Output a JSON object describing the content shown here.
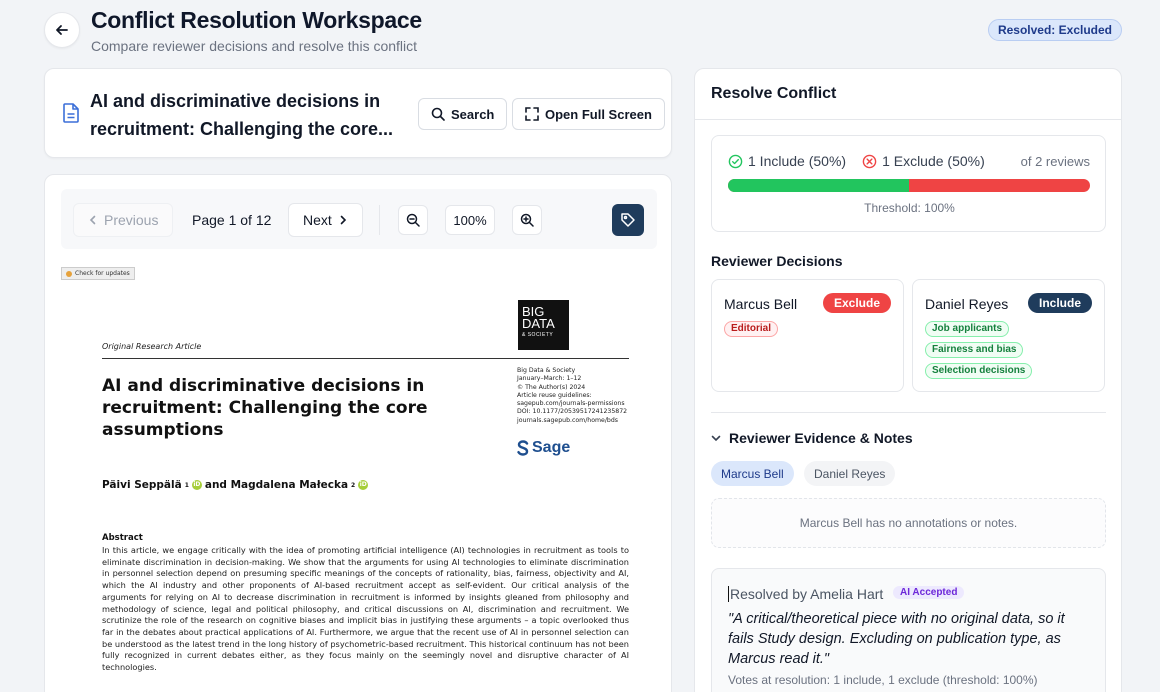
{
  "header": {
    "title": "Conflict Resolution Workspace",
    "subtitle": "Compare reviewer decisions and resolve this conflict",
    "status": "Resolved: Excluded"
  },
  "document": {
    "title": "AI and discriminative decisions in recruitment: Challenging the core...",
    "search_label": "Search",
    "fullscreen_label": "Open Full Screen"
  },
  "viewer": {
    "prev_label": "Previous",
    "page_label": "Page 1 of 12",
    "next_label": "Next",
    "zoom": "100%"
  },
  "paper": {
    "check_updates": "Check for updates",
    "article_type": "Original Research Article",
    "logo_line1": "BIG",
    "logo_line2": "DATA",
    "logo_line3": "& SOCIETY",
    "title": "AI and discriminative decisions in recruitment: Challenging the core assumptions",
    "journal_info": [
      "Big Data & Society",
      "January–March: 1–12",
      "© The Author(s) 2024",
      "Article reuse guidelines:",
      "sagepub.com/journals-permissions",
      "DOI: 10.1177/20539517241235872",
      "journals.sagepub.com/home/bds"
    ],
    "publisher": "Sage",
    "author1": "Päivi Seppälä",
    "author1_sup": "1",
    "author_and": "and Magdalena Małecka",
    "author2_sup": "2",
    "abstract_title": "Abstract",
    "abstract_text": "In this article, we engage critically with the idea of promoting artificial intelligence (AI) technologies in recruitment as tools to eliminate discrimination in decision-making. We show that the arguments for using AI technologies to eliminate discrimination in personnel selection depend on presuming specific meanings of the concepts of rationality, bias, fairness, objectivity and AI, which the AI industry and other proponents of AI-based recruitment accept as self-evident. Our critical analysis of the arguments for relying on AI to decrease discrimination in recruitment is informed by insights gleaned from philosophy and methodology of science, legal and political philosophy, and critical discussions on AI, discrimination and recruitment. We scrutinize the role of the research on cognitive biases and implicit bias in justifying these arguments – a topic overlooked thus far in the debates about practical applications of AI. Furthermore, we argue that the recent use of AI in personnel selection can be understood as the latest trend in the long history of psychometric-based recruitment. This historical continuum has not been fully recognized in current debates either, as they focus mainly on the seemingly novel and disruptive character of AI technologies."
  },
  "resolve": {
    "title": "Resolve Conflict",
    "include_text": "1 Include (50%)",
    "exclude_text": "1 Exclude (50%)",
    "of_text": "of 2 reviews",
    "include_fraction": 0.5,
    "threshold": "Threshold: 100%",
    "reviewer_decisions_label": "Reviewer Decisions",
    "reviewers": [
      {
        "name": "Marcus Bell",
        "decision": "Exclude",
        "tags": [
          "Editorial"
        ]
      },
      {
        "name": "Daniel Reyes",
        "decision": "Include",
        "tags": [
          "Job applicants",
          "Fairness and bias",
          "Selection decisions"
        ]
      }
    ],
    "evidence_label": "Reviewer Evidence & Notes",
    "tabs": [
      "Marcus Bell",
      "Daniel Reyes"
    ],
    "notes_empty": "Marcus Bell has no annotations or notes.",
    "resolved_by": "Resolved by Amelia Hart",
    "ai_badge": "AI Accepted",
    "quote": "\"A critical/theoretical piece with no original data, so it fails Study design. Excluding on publication type, as Marcus read it.\"",
    "votes_at_resolution": "Votes at resolution: 1 include, 1 exclude (threshold: 100%)"
  },
  "colors": {
    "include": "#22c55e",
    "exclude": "#ef4444",
    "include_badge": "#1f3c5c",
    "exclude_badge": "#ef4444",
    "accent": "#1f3c5c"
  },
  "icons": {
    "back": "arrow-left-icon",
    "document": "file-text-icon",
    "search": "search-icon",
    "fullscreen": "maximize-icon",
    "prev": "chevron-left-icon",
    "next": "chevron-right-icon",
    "zoom_out": "zoom-out-icon",
    "zoom_in": "zoom-in-icon",
    "tag": "tag-icon",
    "include": "check-circle-icon",
    "exclude": "x-circle-icon",
    "collapse": "chevron-down-icon"
  }
}
